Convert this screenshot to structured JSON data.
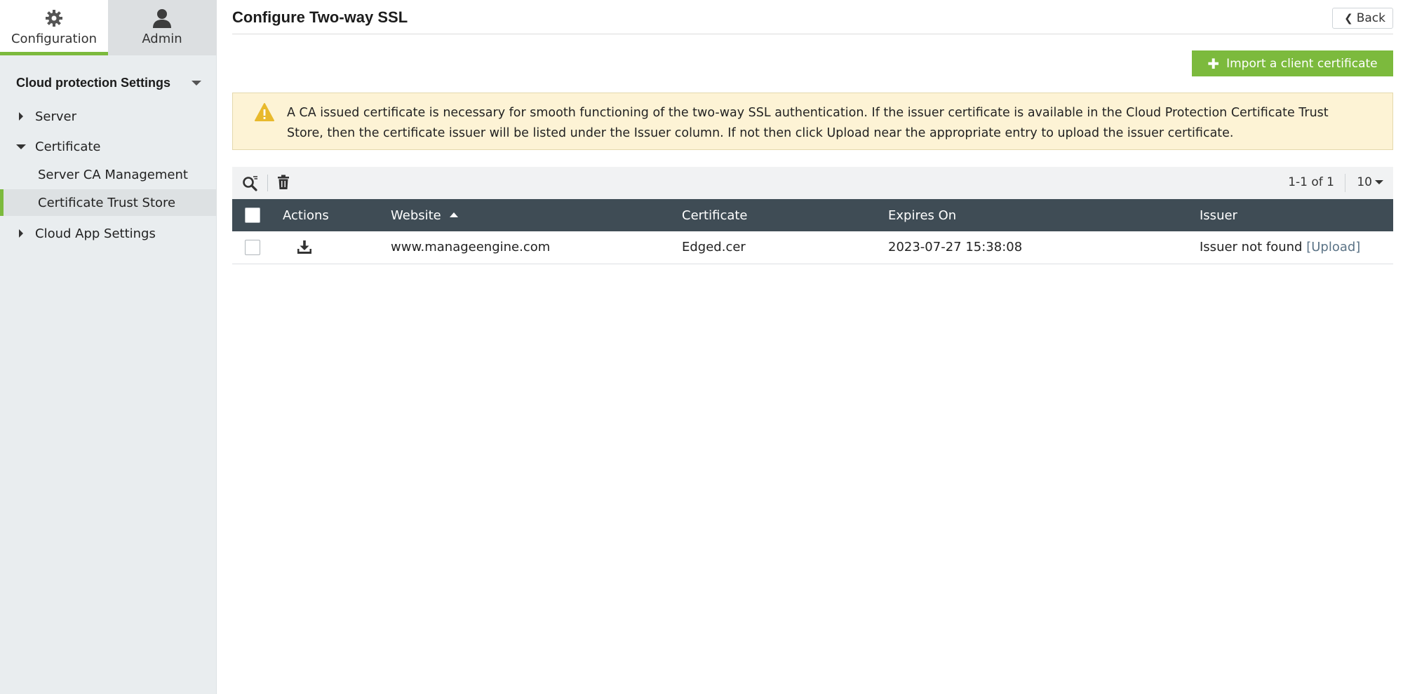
{
  "top_tabs": {
    "configuration": "Configuration",
    "admin": "Admin"
  },
  "sidebar": {
    "section_title": "Cloud protection Settings",
    "items": [
      {
        "label": "Server",
        "expanded": false
      },
      {
        "label": "Certificate",
        "expanded": true
      },
      {
        "label": "Server CA Management"
      },
      {
        "label": "Certificate Trust Store",
        "active": true
      },
      {
        "label": "Cloud App Settings",
        "expanded": false
      }
    ]
  },
  "header": {
    "title": "Configure Two-way SSL",
    "back_label": "Back"
  },
  "toolbar": {
    "import_label": "Import a client certificate"
  },
  "alert": {
    "text": "A CA issued certificate is necessary for smooth functioning of the two-way SSL authentication. If the issuer certificate is available in the Cloud Protection Certificate Trust Store, then the certificate issuer will be listed under the Issuer column. If not then click Upload near the appropriate entry to upload the issuer certificate."
  },
  "grid": {
    "pager_text": "1-1 of 1",
    "page_size": "10",
    "columns": [
      "Actions",
      "Website",
      "Certificate",
      "Expires On",
      "Issuer"
    ],
    "rows": [
      {
        "website": "www.manageengine.com",
        "certificate": "Edged.cer",
        "expires_on": "2023-07-27 15:38:08",
        "issuer": "Issuer not found",
        "upload_link": "[Upload]"
      }
    ]
  },
  "colors": {
    "accent_green": "#7cba3d",
    "table_header": "#3f4c55",
    "alert_bg": "#fdf3d5",
    "warning_icon": "#e8b92c",
    "link": "#5b7386"
  }
}
